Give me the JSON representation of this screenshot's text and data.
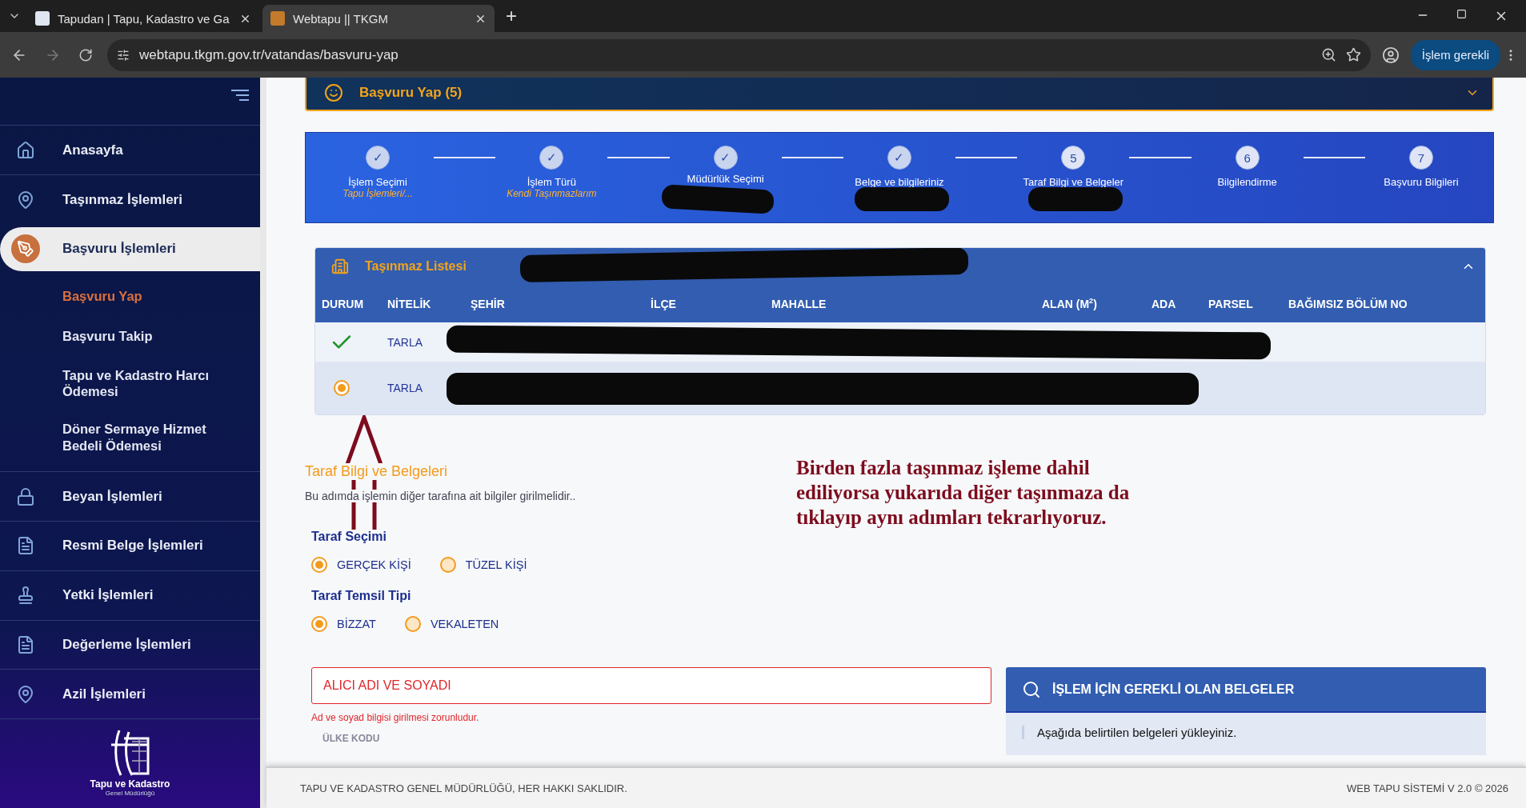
{
  "browser": {
    "tabs": [
      {
        "title": "Tapudan | Tapu, Kadastro ve Ga",
        "selected": false
      },
      {
        "title": "Webtapu || TKGM",
        "selected": true
      }
    ],
    "new_tab": "+",
    "url": "webtapu.tkgm.gov.tr/vatandas/basvuru-yap",
    "forward_disabled": true,
    "action_button": "İşlem gerekli"
  },
  "sidebar": {
    "items": [
      {
        "label": "Anasayfa",
        "selected": false
      },
      {
        "label": "Taşınmaz İşlemleri",
        "selected": false
      },
      {
        "label": "Başvuru İşlemleri",
        "selected": true,
        "children": [
          {
            "label": "Başvuru Yap",
            "selected": true
          },
          {
            "label": "Başvuru Takip",
            "selected": false
          },
          {
            "label": "Tapu ve Kadastro Harcı Ödemesi",
            "selected": false
          },
          {
            "label": "Döner Sermaye Hizmet Bedeli Ödemesi",
            "selected": false
          }
        ]
      },
      {
        "label": "Beyan İşlemleri",
        "selected": false
      },
      {
        "label": "Resmi Belge İşlemleri",
        "selected": false
      },
      {
        "label": "Yetki İşlemleri",
        "selected": false
      },
      {
        "label": "Değerleme İşlemleri",
        "selected": false
      },
      {
        "label": "Azil İşlemleri",
        "selected": false
      }
    ],
    "logo_title": "Tapu ve Kadastro",
    "logo_subtitle": "Genel Müdürlüğü"
  },
  "header_card": {
    "title": "Başvuru Yap (5)",
    "expanded": false
  },
  "stepper": [
    {
      "marker": "✓",
      "label": "İşlem Seçimi",
      "sublabel": "Tapu İşlemleri/...",
      "done": true
    },
    {
      "marker": "✓",
      "label": "İşlem Türü",
      "sublabel": "Kendi Taşınmazlarım",
      "done": true
    },
    {
      "marker": "✓",
      "label": "Müdürlük Seçimi",
      "done": true,
      "redacted": true
    },
    {
      "marker": "✓",
      "label": "Belge ve bilgileriniz",
      "done": true,
      "redacted": true
    },
    {
      "marker": "5",
      "label": "Taraf Bilgi ve Belgeler",
      "done": false,
      "redacted": true
    },
    {
      "marker": "6",
      "label": "Bilgilendirme",
      "done": false
    },
    {
      "marker": "7",
      "label": "Başvuru Bilgileri",
      "done": false
    }
  ],
  "property_list": {
    "title": "Taşınmaz Listesi",
    "title_redacted": true,
    "expanded": true,
    "columns": [
      "DURUM",
      "NİTELİK",
      "ŞEHİR",
      "İLÇE",
      "MAHALLE",
      "ALAN (M$^{2}$)",
      "ADA",
      "PARSEL",
      "BAĞIMSIZ BÖLÜM NO"
    ],
    "rows": [
      {
        "kind": "check",
        "nitelik": "TARLA",
        "selected": false,
        "redacted": true
      },
      {
        "kind": "radio",
        "nitelik": "TARLA",
        "selected": true,
        "redacted": true
      }
    ]
  },
  "form": {
    "title": "Taraf Bilgi ve Belgeleri",
    "subtitle": "Bu adımda işlemin diğer tarafına ait bilgiler girilmelidir..",
    "groups": [
      {
        "label": "Taraf Seçimi",
        "options": [
          {
            "label": "GERÇEK KİŞİ",
            "selected": true
          },
          {
            "label": "TÜZEL KİŞİ",
            "selected": false
          }
        ]
      },
      {
        "label": "Taraf Temsil Tipi",
        "options": [
          {
            "label": "BİZZAT",
            "selected": true
          },
          {
            "label": "VEKALETEN",
            "selected": false
          }
        ]
      }
    ],
    "name_field": {
      "placeholder": "ALICI ADI VE SOYADI",
      "error": "Ad ve soyad bilgisi girilmesi zorunludur."
    },
    "next_label": "ÜLKE KODU"
  },
  "documents_panel": {
    "title": "İŞLEM İÇİN GEREKLİ OLAN BELGELER",
    "text": "Aşağıda belirtilen belgeleri yükleyiniz."
  },
  "annotation": {
    "lines": [
      "Birden fazla taşınmaz işleme dahil",
      "ediliyorsa yukarıda diğer taşınmaza da",
      "tıklayıp aynı adımları tekrarlıyoruz."
    ]
  },
  "footer": {
    "left": "TAPU VE KADASTRO GENEL MÜDÜRLÜĞÜ, HER HAKKI SAKLIDIR.",
    "right": "WEB TAPU SİSTEMİ V 2.0 © 2026"
  }
}
